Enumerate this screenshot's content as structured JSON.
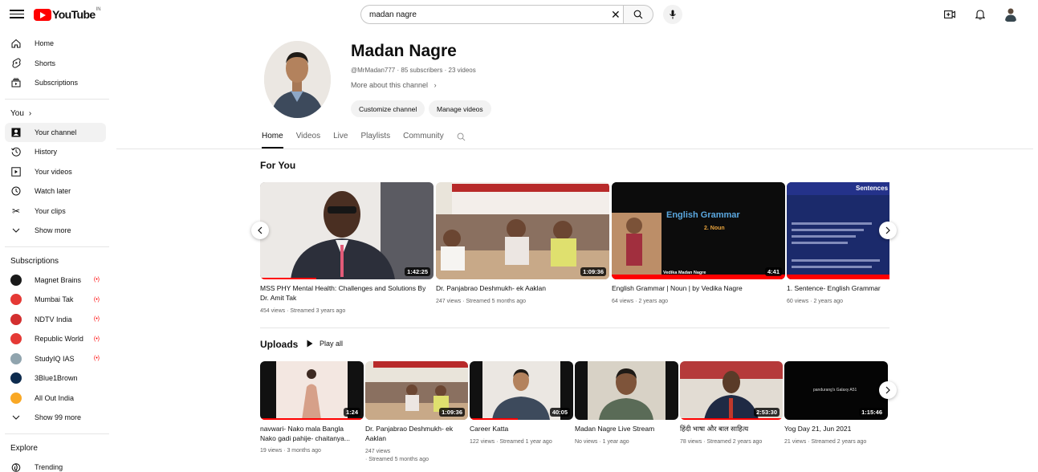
{
  "topbar": {
    "logo_text": "YouTube",
    "region": "IN",
    "search_value": "madan nagre"
  },
  "sidebar": {
    "main": [
      {
        "label": "Home",
        "icon": "home-icon"
      },
      {
        "label": "Shorts",
        "icon": "shorts-icon"
      },
      {
        "label": "Subscriptions",
        "icon": "subscriptions-icon"
      }
    ],
    "you_heading": "You",
    "you": [
      {
        "label": "Your channel",
        "icon": "your-channel-icon",
        "active": true
      },
      {
        "label": "History",
        "icon": "history-icon"
      },
      {
        "label": "Your videos",
        "icon": "your-videos-icon"
      },
      {
        "label": "Watch later",
        "icon": "watch-later-icon"
      },
      {
        "label": "Your clips",
        "icon": "scissors-icon"
      },
      {
        "label": "Show more",
        "icon": "chevron-down-icon"
      }
    ],
    "subs_heading": "Subscriptions",
    "subs": [
      {
        "label": "Magnet Brains",
        "color": "#1a1a1a",
        "live": "(•)"
      },
      {
        "label": "Mumbai Tak",
        "color": "#e53935",
        "live": "(•)"
      },
      {
        "label": "NDTV India",
        "color": "#d32f2f",
        "live": "(•)"
      },
      {
        "label": "Republic World",
        "color": "#e53935",
        "live": "(•)"
      },
      {
        "label": "StudyIQ IAS",
        "color": "#90a4ae",
        "live": "(•)"
      },
      {
        "label": "3Blue1Brown",
        "color": "#0d2b4e",
        "live": ""
      },
      {
        "label": "All Out India",
        "color": "#f9a825",
        "live": ""
      },
      {
        "label": "Show 99 more",
        "color": "",
        "live": ""
      }
    ],
    "explore_heading": "Explore",
    "explore": [
      {
        "label": "Trending",
        "icon": "trending-icon"
      }
    ]
  },
  "channel": {
    "name": "Madan Nagre",
    "meta": "@MrMadan777 · 85 subscribers · 23 videos",
    "more": "More about this channel",
    "customize": "Customize channel",
    "manage": "Manage videos"
  },
  "tabs": [
    "Home",
    "Videos",
    "Live",
    "Playlists",
    "Community"
  ],
  "for_you": {
    "title": "For You",
    "videos": [
      {
        "title": "MSS PHY Mental Health: Challenges and Solutions By Dr. Amit Tak",
        "meta": "454 views · Streamed 3 years ago",
        "duration": "1:42:25"
      },
      {
        "title": "Dr. Panjabrao Deshmukh- ek Aaklan",
        "meta": "247 views · Streamed 5 months ago",
        "duration": "1:09:36"
      },
      {
        "title": "English Grammar | Noun | by Vedika Nagre",
        "meta": "64 views · 2 years ago",
        "duration": "4:41",
        "thumb_title": "English Grammar",
        "thumb_sub": "2. Noun",
        "thumb_caption": "Vedika Madan Nagre"
      },
      {
        "title": "1. Sentence- English Grammar",
        "meta": "60 views · 2 years ago",
        "duration": "",
        "thumb_title": "Sentences"
      }
    ]
  },
  "uploads": {
    "title": "Uploads",
    "play_all": "Play all",
    "videos": [
      {
        "title": "navwari- Nako mala Bangla Nako gadi pahije- chaitanya...",
        "meta": "19 views · 3 months ago",
        "duration": "1:24"
      },
      {
        "title": "Dr. Panjabrao Deshmukh- ek Aaklan",
        "meta": "247 views",
        "meta2": "· Streamed 5 months ago",
        "duration": "1:09:36"
      },
      {
        "title": "Career Katta",
        "meta": "122 views · Streamed 1 year ago",
        "duration": "40:05"
      },
      {
        "title": "Madan Nagre Live Stream",
        "meta": "No views · 1 year ago",
        "duration": ""
      },
      {
        "title": "हिंदी भाषा और बाल साहित्य",
        "meta": "78 views · Streamed 2 years ago",
        "duration": "2:53:30"
      },
      {
        "title": "Yog Day 21, Jun 2021",
        "meta": "21 views · Streamed 2 years ago",
        "duration": "1:15:46",
        "thumb_caption": "pandurang's Galaxy A51"
      }
    ]
  }
}
